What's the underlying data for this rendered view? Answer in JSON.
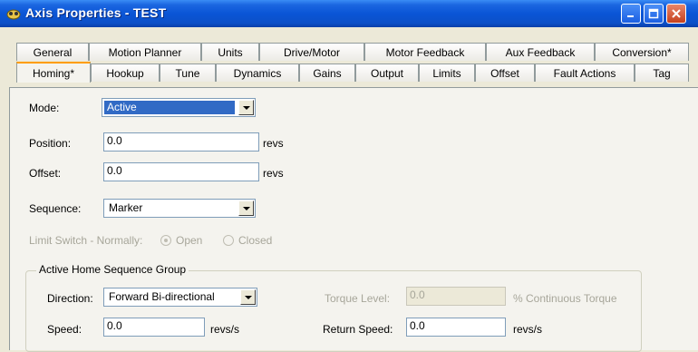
{
  "window": {
    "title": "Axis Properties - TEST"
  },
  "tabs": {
    "row1": [
      "General",
      "Motion Planner",
      "Units",
      "Drive/Motor",
      "Motor Feedback",
      "Aux Feedback",
      "Conversion*"
    ],
    "row2": [
      "Homing*",
      "Hookup",
      "Tune",
      "Dynamics",
      "Gains",
      "Output",
      "Limits",
      "Offset",
      "Fault Actions",
      "Tag"
    ],
    "selected": "Homing*"
  },
  "form": {
    "mode": {
      "label": "Mode:",
      "value": "Active"
    },
    "position": {
      "label": "Position:",
      "value": "0.0",
      "unit": "revs"
    },
    "offset": {
      "label": "Offset:",
      "value": "0.0",
      "unit": "revs"
    },
    "sequence": {
      "label": "Sequence:",
      "value": "Marker"
    },
    "limit_switch": {
      "label": "Limit Switch - Normally:",
      "open": "Open",
      "closed": "Closed",
      "selected": "Open"
    }
  },
  "group": {
    "title": "Active Home Sequence Group",
    "direction": {
      "label": "Direction:",
      "value": "Forward Bi-directional"
    },
    "torque_level": {
      "label": "Torque Level:",
      "value": "0.0",
      "unit": "% Continuous Torque"
    },
    "speed": {
      "label": "Speed:",
      "value": "0.0",
      "unit": "revs/s"
    },
    "return_speed": {
      "label": "Return Speed:",
      "value": "0.0",
      "unit": "revs/s"
    }
  }
}
